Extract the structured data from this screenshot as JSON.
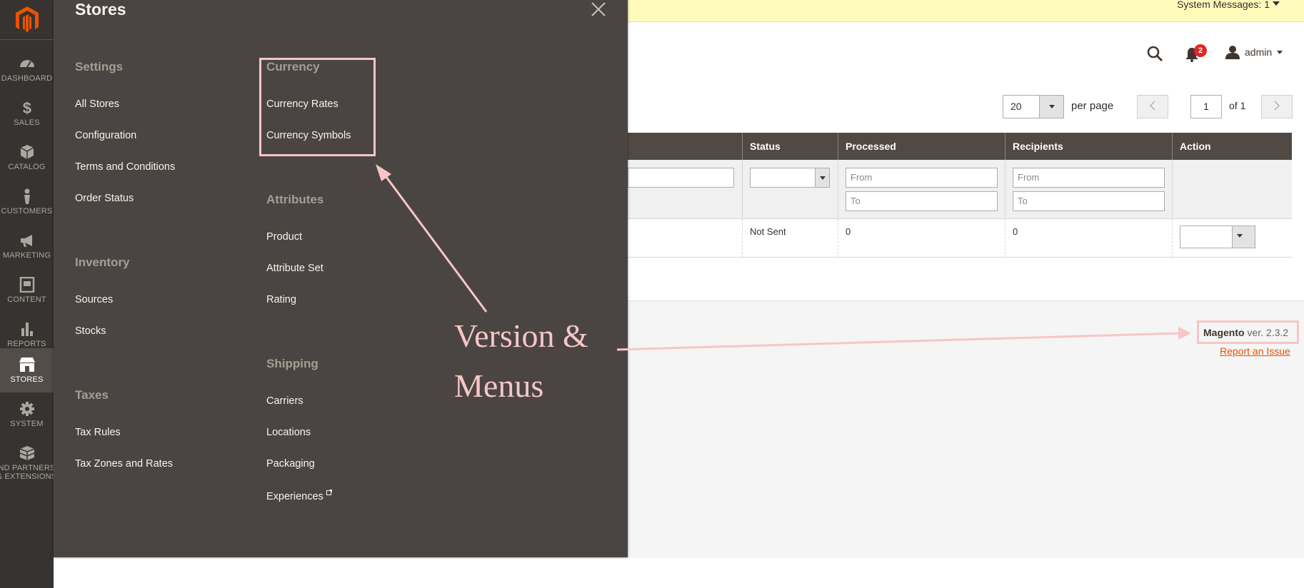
{
  "nav": {
    "items": [
      {
        "label": "DASHBOARD",
        "icon": "dashboard-icon"
      },
      {
        "label": "SALES",
        "icon": "dollar-icon"
      },
      {
        "label": "CATALOG",
        "icon": "box-icon"
      },
      {
        "label": "CUSTOMERS",
        "icon": "person-icon"
      },
      {
        "label": "MARKETING",
        "icon": "megaphone-icon"
      },
      {
        "label": "CONTENT",
        "icon": "content-icon"
      },
      {
        "label": "REPORTS",
        "icon": "bar-chart-icon"
      },
      {
        "label": "STORES",
        "icon": "store-icon"
      },
      {
        "label": "SYSTEM",
        "icon": "gear-icon"
      },
      {
        "label": "FIND PARTNERS & EXTENSIONS",
        "line1": "ND PARTNERS",
        "line2": "& EXTENSIONS",
        "icon": "partners-box-icon"
      }
    ]
  },
  "flyout": {
    "title": "Stores",
    "groups": {
      "settings": {
        "title": "Settings",
        "items": [
          "All Stores",
          "Configuration",
          "Terms and Conditions",
          "Order Status"
        ]
      },
      "inventory": {
        "title": "Inventory",
        "items": [
          "Sources",
          "Stocks"
        ]
      },
      "taxes": {
        "title": "Taxes",
        "items": [
          "Tax Rules",
          "Tax Zones and Rates"
        ]
      },
      "currency": {
        "title": "Currency",
        "items": [
          "Currency Rates",
          "Currency Symbols"
        ]
      },
      "attributes": {
        "title": "Attributes",
        "items": [
          "Product",
          "Attribute Set",
          "Rating"
        ]
      },
      "shipping": {
        "title": "Shipping",
        "items": [
          "Carriers",
          "Locations",
          "Packaging",
          "Experiences"
        ]
      }
    }
  },
  "header": {
    "system_messages": "System Messages: 1",
    "notifications_count": "2",
    "user": "admin"
  },
  "pager": {
    "per_page_value": "20",
    "per_page_label": "per page",
    "page_value": "1",
    "of_label": "of 1"
  },
  "grid": {
    "columns": [
      "Status",
      "Processed",
      "Recipients",
      "Action"
    ],
    "filters": {
      "from": "From",
      "to": "To"
    },
    "row": {
      "status": "Not Sent",
      "processed": "0",
      "recipients": "0"
    }
  },
  "footer": {
    "brand": "Magento",
    "version": " ver. 2.3.2",
    "report": "Report an Issue"
  },
  "annotation": {
    "line1": "Version &",
    "line2": "Menus",
    "color": "#f6c6c6"
  },
  "colors": {
    "nav_bg": "#373330",
    "flyout_bg": "#4a4542",
    "brand_orange": "#eb5202",
    "grid_header": "#514943"
  }
}
